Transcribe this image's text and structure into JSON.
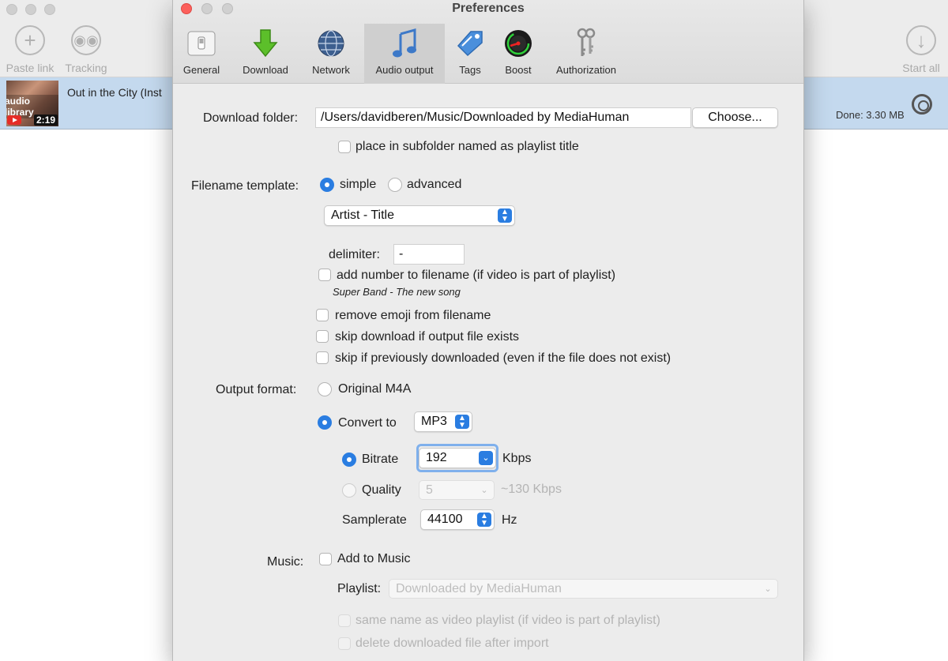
{
  "main_window": {
    "toolbar": {
      "paste_link": "Paste link",
      "tracking": "Tracking",
      "start_all": "Start all"
    },
    "download_item": {
      "title": "Out in the City (Inst",
      "thumb_text": "audio library",
      "duration": "2:19",
      "status": "Done: 3.30 MB"
    }
  },
  "prefs": {
    "title": "Preferences",
    "tabs": [
      {
        "label": "General",
        "icon": "switch-icon"
      },
      {
        "label": "Download",
        "icon": "download-arrow-icon"
      },
      {
        "label": "Network",
        "icon": "globe-icon"
      },
      {
        "label": "Audio output",
        "icon": "music-note-icon",
        "active": true
      },
      {
        "label": "Tags",
        "icon": "tag-icon"
      },
      {
        "label": "Boost",
        "icon": "speedometer-icon"
      },
      {
        "label": "Authorization",
        "icon": "keys-icon"
      }
    ],
    "download_folder": {
      "label": "Download folder:",
      "path": "/Users/davidberen/Music/Downloaded by MediaHuman",
      "choose": "Choose...",
      "subfolder": "place in subfolder named as playlist title"
    },
    "filename_template": {
      "label": "Filename template:",
      "simple": "simple",
      "advanced": "advanced",
      "selected": "simple",
      "pattern": "Artist - Title",
      "delimiter_label": "delimiter:",
      "delimiter_value": "-",
      "add_number": "add number to filename (if video is part of playlist)",
      "example": "Super Band - The new song",
      "remove_emoji": "remove emoji from filename",
      "skip_exists": "skip download if output file exists",
      "skip_previous": "skip if previously downloaded (even if the file does not exist)"
    },
    "output_format": {
      "label": "Output format:",
      "original": "Original M4A",
      "convert_to": "Convert to",
      "format": "MP3",
      "bitrate_label": "Bitrate",
      "bitrate_value": "192",
      "bitrate_unit": "Kbps",
      "quality_label": "Quality",
      "quality_value": "5",
      "quality_hint": "~130 Kbps",
      "samplerate_label": "Samplerate",
      "samplerate_value": "44100",
      "samplerate_unit": "Hz"
    },
    "music": {
      "label": "Music:",
      "add_to_music": "Add to Music",
      "playlist_label": "Playlist:",
      "playlist_value": "Downloaded by MediaHuman",
      "same_name": "same name as video playlist (if video is part of playlist)",
      "delete_after": "delete downloaded file after import"
    }
  },
  "colors": {
    "accent": "#2a7de1",
    "close_button": "#fc605c",
    "selection_row": "#c4d9ee"
  }
}
